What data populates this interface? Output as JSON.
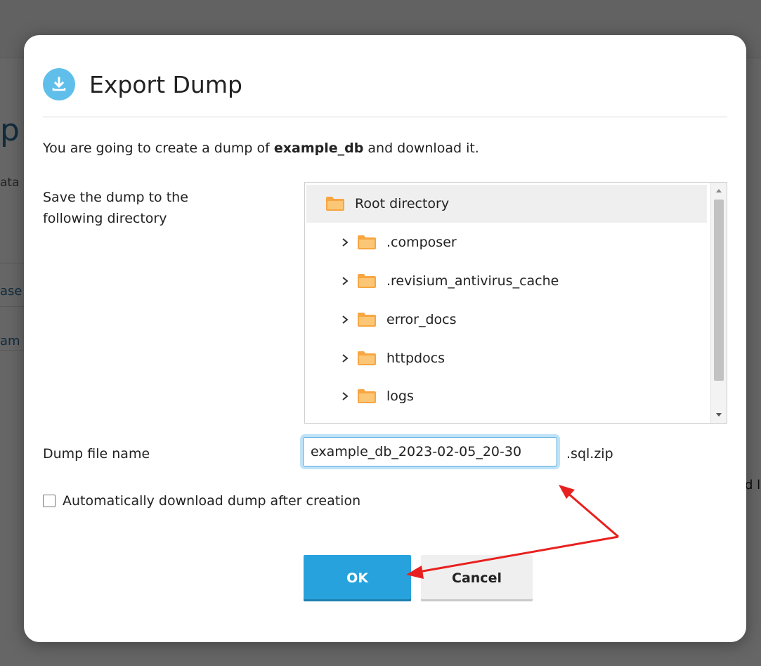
{
  "background": {
    "fragments": [
      "p",
      "ata",
      "ase",
      "am",
      "d l"
    ]
  },
  "dialog": {
    "title": "Export Dump",
    "title_icon": "download-icon",
    "intro_prefix": "You are going to create a dump of ",
    "intro_db": "example_db",
    "intro_suffix": " and download it.",
    "directory_label": "Save the dump to the following directory",
    "tree": {
      "root": {
        "label": "Root directory",
        "icon": "folder-icon"
      },
      "children": [
        {
          "label": ".composer",
          "icon": "folder-icon"
        },
        {
          "label": ".revisium_antivirus_cache",
          "icon": "folder-icon"
        },
        {
          "label": "error_docs",
          "icon": "folder-icon"
        },
        {
          "label": "httpdocs",
          "icon": "folder-icon"
        },
        {
          "label": "logs",
          "icon": "folder-icon"
        }
      ]
    },
    "file_name_label": "Dump file name",
    "file_name_value": "example_db_2023-02-05_20-30",
    "file_name_suffix": ".sql.zip",
    "auto_download_label": "Automatically download dump after creation",
    "auto_download_checked": false,
    "ok_label": "OK",
    "cancel_label": "Cancel"
  },
  "colors": {
    "accent": "#27a2dc",
    "icon_bg": "#5fbfea",
    "folder": "#f7a642",
    "annotation": "#e8201f"
  }
}
